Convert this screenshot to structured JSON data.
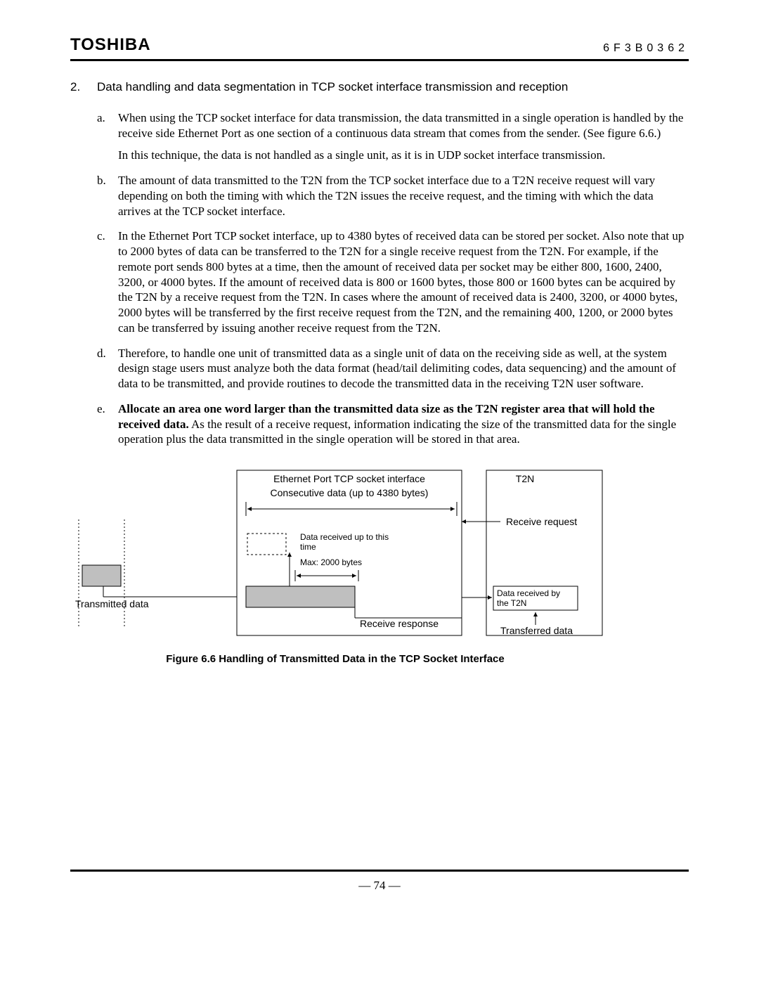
{
  "header": {
    "logo": "TOSHIBA",
    "docnum": "6F3B0362"
  },
  "main": {
    "number": "2.",
    "title": "Data handling and data segmentation in TCP socket interface transmission and reception",
    "items": [
      {
        "marker": "a.",
        "paras": [
          "When using the TCP socket interface for data transmission, the data transmitted in a single operation is handled by the receive side Ethernet Port as one section of a continuous data stream that comes from the sender. (See figure 6.6.)",
          "In this technique, the data is not handled as a single unit, as it is in UDP socket interface transmission."
        ]
      },
      {
        "marker": "b.",
        "paras": [
          "The amount of data transmitted to the T2N from the TCP socket interface due to a T2N receive request will vary depending on both the timing with which the T2N issues the receive request, and the timing with which the data arrives at the TCP socket interface."
        ]
      },
      {
        "marker": "c.",
        "paras": [
          "In the Ethernet Port TCP socket interface, up to 4380 bytes of received data can be stored per socket. Also note that up to 2000 bytes of data can be transferred to the T2N for a single receive request from the T2N. For example, if the remote port sends 800 bytes at a time, then the amount of received data per socket may be either 800, 1600, 2400, 3200, or 4000 bytes. If the amount of received data is 800 or 1600 bytes, those 800 or 1600 bytes can be acquired by the T2N by a receive request from the T2N. In cases where the amount of received data is 2400, 3200, or 4000 bytes, 2000 bytes will be transferred by the first receive request from the T2N, and the remaining 400, 1200, or 2000 bytes can be transferred by issuing another receive request from the T2N."
        ]
      },
      {
        "marker": "d.",
        "paras": [
          "Therefore, to handle one unit of transmitted data as a single unit of data on the receiving side as well, at the system design stage users must analyze both the data format (head/tail delimiting codes, data sequencing) and the amount of data to be transmitted, and provide routines to decode the transmitted data in the receiving T2N user software."
        ]
      },
      {
        "marker": "e.",
        "bold_lead": "Allocate an area one word larger than the transmitted data size as the T2N register area that will hold the received data.",
        "rest": " As the result of a receive request, information indicating the size of the transmitted data for the single operation plus the data transmitted in the single operation will be stored in that area."
      }
    ]
  },
  "figure": {
    "labels": {
      "ethernet": "Ethernet Port TCP socket interface",
      "t2n": "T2N",
      "consecutive": "Consecutive data (up to 4380 bytes)",
      "rxreq": "Receive request",
      "rxuptotime_l1": "Data received up to this",
      "rxuptotime_l2": "time",
      "max2000": "Max: 2000 bytes",
      "transmitted": "Transmitted data",
      "rxresp": "Receive response",
      "rxbyT2N_l1": "Data received by",
      "rxbyT2N_l2": "the T2N",
      "transferred": "Transferred data"
    },
    "caption": "Figure 6.6    Handling of Transmitted Data in the TCP Socket Interface"
  },
  "footer": {
    "pagenum": "— 74 —"
  }
}
